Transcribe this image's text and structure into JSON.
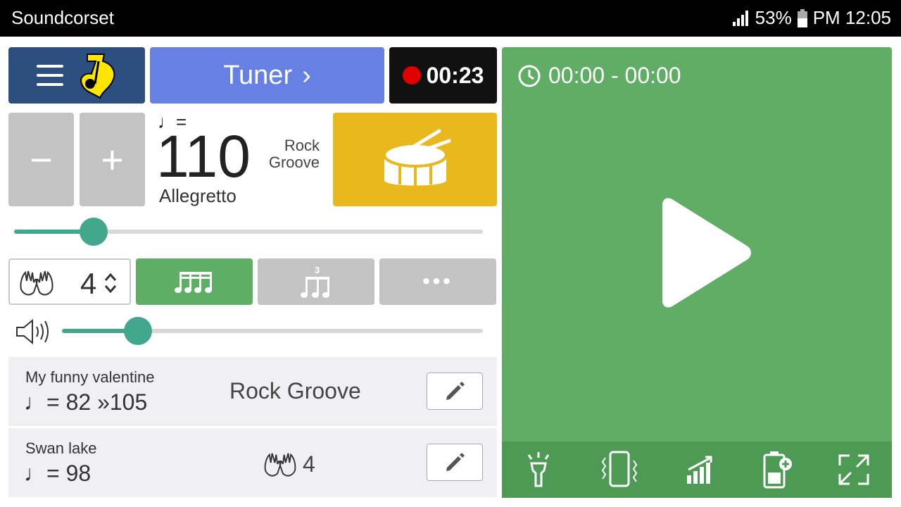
{
  "statusbar": {
    "app_title": "Soundcorset",
    "battery": "53%",
    "time": "PM 12:05"
  },
  "header": {
    "tuner_label": "Tuner",
    "tuner_chevron": "›",
    "record_time": "00:23"
  },
  "tempo": {
    "minus_label": "−",
    "plus_label": "+",
    "note_label": "♩=",
    "bpm": "110",
    "tempo_name": "Allegretto",
    "groove_name": "Rock Groove",
    "slider_fraction": 0.17
  },
  "beats": {
    "value": "4"
  },
  "subdivisions": {
    "more_label": "•••",
    "triplet_number": "3"
  },
  "volume": {
    "fraction": 0.18
  },
  "setlist": [
    {
      "title": "My funny valentine",
      "tempo": "♩= 82 »105",
      "center": "Rock Groove"
    },
    {
      "title": "Swan lake",
      "tempo": "♩= 98",
      "center": "4"
    }
  ],
  "player": {
    "time_range": "00:00 - 00:00"
  },
  "colors": {
    "green": "#60ae66",
    "blue": "#6680e3",
    "navy": "#2d4f80",
    "yellow": "#e8b81c",
    "teal": "#43a78e",
    "record_red": "#e00000"
  },
  "icons": [
    "hamburger-icon",
    "app-logo-icon",
    "chevron-right-icon",
    "record-dot-icon",
    "drum-icon",
    "hands-icon",
    "updown-arrows-icon",
    "sixteenth-notes-icon",
    "triplet-notes-icon",
    "more-dots-icon",
    "speaker-icon",
    "pencil-icon",
    "clock-icon",
    "play-icon",
    "flashlight-icon",
    "vibrate-icon",
    "signal-bars-icon",
    "battery-plus-icon",
    "fullscreen-icon"
  ]
}
